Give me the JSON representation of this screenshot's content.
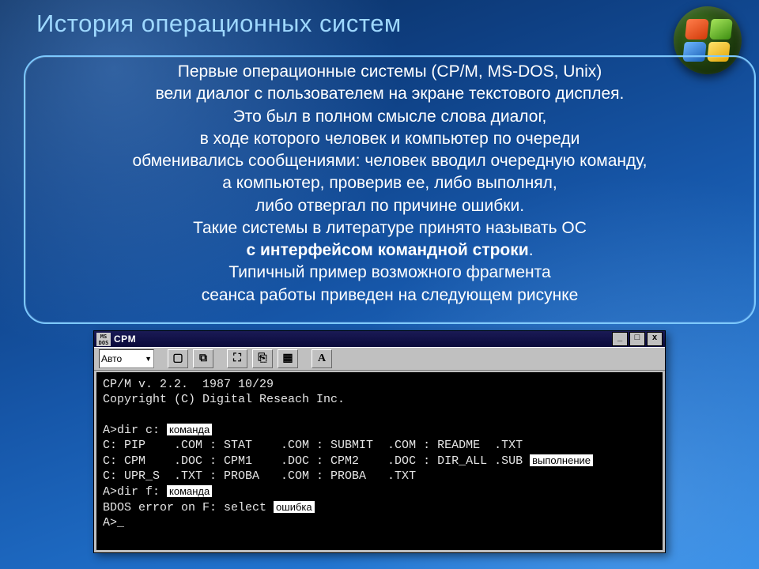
{
  "title": "История операционных систем",
  "paragraphs": [
    {
      "t": "Первые операционные системы (CP/M, MS-DOS, Unix)",
      "b": false
    },
    {
      "t": "вели диалог с пользователем на экране текстового дисплея.",
      "b": false
    },
    {
      "t": "Это был в полном смысле слова диалог,",
      "b": false
    },
    {
      "t": "в ходе которого человек и компьютер по очереди",
      "b": false
    },
    {
      "t": "обменивались сообщениями: человек вводил очередную команду,",
      "b": false
    },
    {
      "t": "а компьютер, проверив ее, либо выполнял,",
      "b": false
    },
    {
      "t": "либо отвергал по причине ошибки.",
      "b": false
    },
    {
      "t": "Такие системы в литературе принято называть ОС",
      "b": false
    },
    {
      "t": "с интерфейсом командной строки",
      "b": true,
      "after": "."
    },
    {
      "t": "Типичный пример возможного фрагмента",
      "b": false
    },
    {
      "t": "сеанса работы приведен на следующем рисунке",
      "b": false
    }
  ],
  "terminal": {
    "icon_label": "MS\nDOS",
    "title": "CPM",
    "win_buttons": {
      "min": "_",
      "max": "□",
      "close": "x"
    },
    "combo": "Авто",
    "toolbar_glyphs": [
      "▢",
      "⧉",
      "⛶",
      "⎘",
      "▦",
      "A"
    ],
    "tags": {
      "cmd": "команда",
      "exec": "выполнение",
      "err": "ошибка"
    },
    "lines": {
      "l1": "CP/M v. 2.2.  1987 10/29",
      "l2": "Copyright (C) Digital Reseach Inc.",
      "blank": " ",
      "p_dir_c": "A>dir c: ",
      "row1": "C: PIP    .COM : STAT    .COM : SUBMIT  .COM : README  .TXT",
      "row2": "C: CPM    .DOC : CPM1    .DOC : CPM2    .DOC : DIR_ALL .SUB ",
      "row3": "C: UPR_S  .TXT : PROBA   .COM : PROBA   .TXT",
      "p_dir_f": "A>dir f: ",
      "err": "BDOS error on F: select ",
      "prompt": "A>_"
    }
  }
}
